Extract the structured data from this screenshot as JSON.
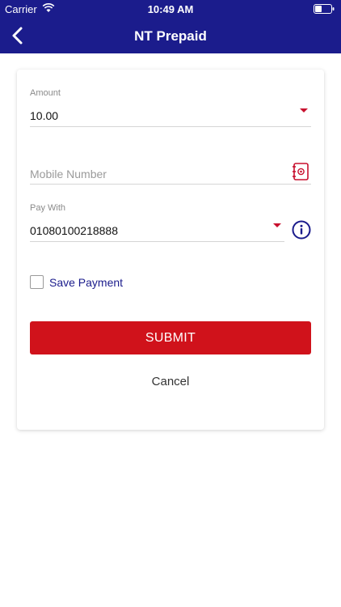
{
  "status": {
    "carrier": "Carrier",
    "time": "10:49 AM"
  },
  "nav": {
    "title": "NT Prepaid"
  },
  "form": {
    "amount_label": "Amount",
    "amount_value": "10.00",
    "mobile_placeholder": "Mobile Number",
    "pay_with_label": "Pay With",
    "pay_with_value": "01080100218888",
    "save_payment_label": "Save Payment",
    "submit_label": "SUBMIT",
    "cancel_label": "Cancel"
  },
  "icons": {
    "back": "chevron-left-icon",
    "contacts": "contact-book-icon",
    "info": "info-icon",
    "dropdown": "caret-down-icon"
  },
  "colors": {
    "brand_navy": "#1b1c8c",
    "accent_red": "#d0121b"
  }
}
